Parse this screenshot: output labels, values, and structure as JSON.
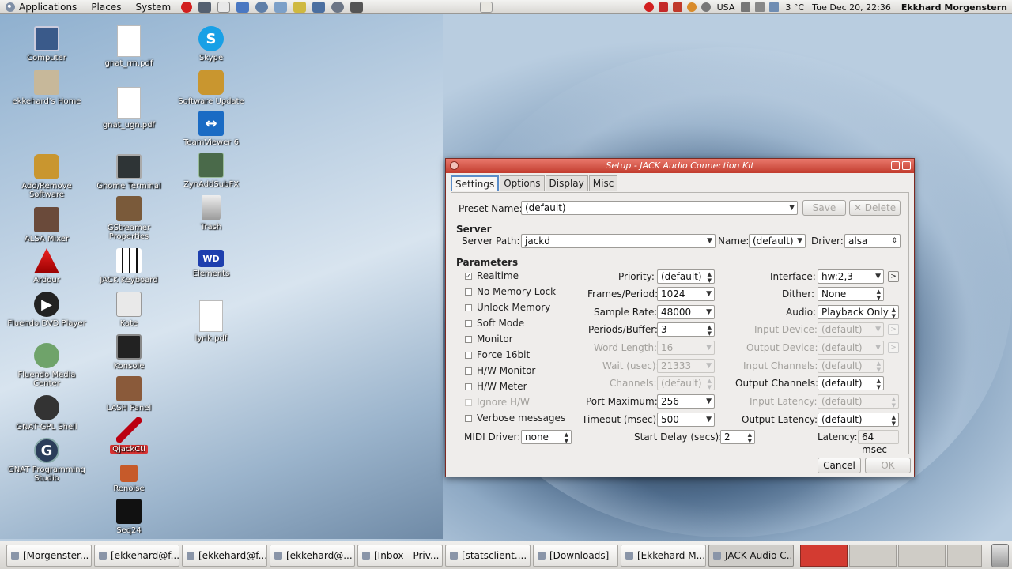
{
  "top_panel": {
    "menus": [
      "Applications",
      "Places",
      "System"
    ],
    "temperature": "3 °C",
    "keyboard_layout": "USA",
    "datetime": "Tue Dec 20, 22:36",
    "user": "Ekkhard Morgenstern"
  },
  "desktop": {
    "computer": "Computer",
    "home": "ekkehard's Home",
    "add_remove": "Add/Remove Software",
    "alsa": "ALSA Mixer",
    "ardour": "Ardour",
    "fluendo_dvd": "Fluendo DVD Player",
    "fluendo_media": "Fluendo Media Center",
    "gnat_shell": "GNAT-GPL Shell",
    "gnat_studio": "GNAT Programming Studio",
    "gnat_rm": "gnat_rm.pdf",
    "gnat_ugn": "gnat_ugn.pdf",
    "gnome_terminal": "Gnome Terminal",
    "gstreamer": "GStreamer Properties",
    "jack_keyboard": "JACK Keyboard",
    "kate": "Kate",
    "konsole": "Konsole",
    "lash": "LASH Panel",
    "qjackctl": "QjackCtl",
    "renoise": "Renoise",
    "seq24": "Seq24",
    "skype": "Skype",
    "software_update": "Software Update",
    "teamviewer": "TeamViewer 6",
    "zyn": "ZynAddSubFX",
    "trash": "Trash",
    "elements": "Elements",
    "lyrik": "lyrik.pdf"
  },
  "window": {
    "title": "Setup - JACK Audio Connection Kit",
    "tabs": [
      "Settings",
      "Options",
      "Display",
      "Misc"
    ],
    "preset_label": "Preset Name:",
    "preset_value": "(default)",
    "save": "Save",
    "delete": "Delete",
    "server_section": "Server",
    "server_path_label": "Server Path:",
    "server_path_value": "jackd",
    "name_label": "Name:",
    "name_value": "(default)",
    "driver_label": "Driver:",
    "driver_value": "alsa",
    "params_section": "Parameters",
    "checks": {
      "realtime": "Realtime",
      "no_memory_lock": "No Memory Lock",
      "unlock_memory": "Unlock Memory",
      "soft_mode": "Soft Mode",
      "monitor": "Monitor",
      "force16": "Force 16bit",
      "hw_monitor": "H/W Monitor",
      "hw_meter": "H/W Meter",
      "ignore_hw": "Ignore H/W",
      "verbose": "Verbose messages"
    },
    "realtime_checked": true,
    "midi_driver_label": "MIDI Driver:",
    "midi_driver_value": "none",
    "priority_label": "Priority:",
    "priority_value": "(default)",
    "frames_label": "Frames/Period:",
    "frames_value": "1024",
    "sample_rate_label": "Sample Rate:",
    "sample_rate_value": "48000",
    "periods_label": "Periods/Buffer:",
    "periods_value": "3",
    "word_length_label": "Word Length:",
    "word_length_value": "16",
    "wait_label": "Wait (usec):",
    "wait_value": "21333",
    "channels_label": "Channels:",
    "channels_value": "(default)",
    "port_max_label": "Port Maximum:",
    "port_max_value": "256",
    "timeout_label": "Timeout (msec):",
    "timeout_value": "500",
    "start_delay_label": "Start Delay (secs):",
    "start_delay_value": "2",
    "interface_label": "Interface:",
    "interface_value": "hw:2,3",
    "dither_label": "Dither:",
    "dither_value": "None",
    "audio_label": "Audio:",
    "audio_value": "Playback Only",
    "input_device_label": "Input Device:",
    "input_device_value": "(default)",
    "output_device_label": "Output Device:",
    "output_device_value": "(default)",
    "input_channels_label": "Input Channels:",
    "input_channels_value": "(default)",
    "output_channels_label": "Output Channels:",
    "output_channels_value": "(default)",
    "input_latency_label": "Input Latency:",
    "input_latency_value": "(default)",
    "output_latency_label": "Output Latency:",
    "output_latency_value": "(default)",
    "latency_label": "Latency:",
    "latency_value": "64 msec",
    "cancel": "Cancel",
    "ok": "OK"
  },
  "taskbar": [
    "[Morgenster...",
    "[ekkehard@f...",
    "[ekkehard@f...",
    "[ekkehard@...",
    "[Inbox - Priv...",
    "[statsclient....",
    "[Downloads]",
    "[Ekkehard M...",
    "JACK Audio C..."
  ],
  "colors": {
    "titlebar": "#c23c2e",
    "accent_tab": "#5b8dc9",
    "selected_icon": "#d93232"
  }
}
